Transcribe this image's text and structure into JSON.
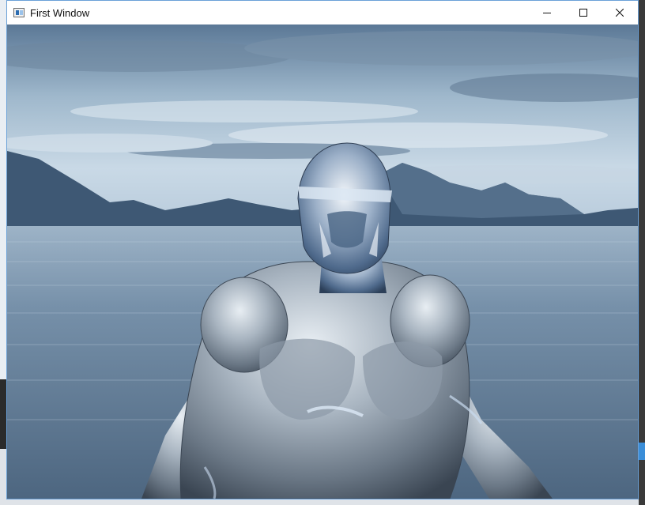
{
  "window": {
    "title": "First Window",
    "icon": "application-icon",
    "controls": {
      "minimize": "minimize-icon",
      "maximize": "maximize-icon",
      "close": "close-icon"
    }
  },
  "scene": {
    "description_icons": [
      "sky",
      "mountains",
      "lake",
      "chrome-figure"
    ],
    "colors": {
      "sky_top": "#4f6d8c",
      "sky_mid": "#b9cfdf",
      "water": "#6f8aa3",
      "mountain": "#3d566f",
      "chrome": "#b8c4cf"
    }
  }
}
